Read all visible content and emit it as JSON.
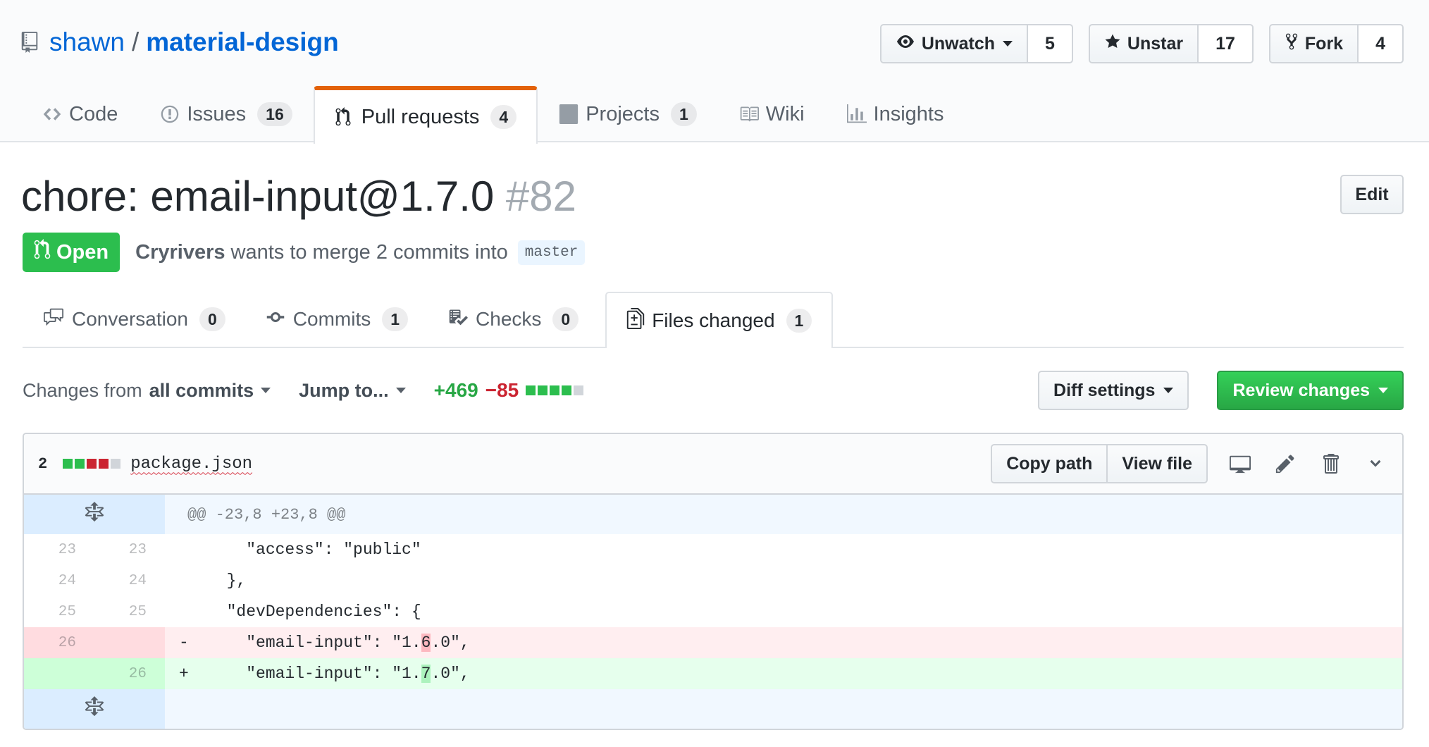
{
  "repo": {
    "owner": "shawn",
    "separator": "/",
    "name": "material-design"
  },
  "actions": {
    "watch": {
      "label": "Unwatch",
      "count": "5"
    },
    "star": {
      "label": "Unstar",
      "count": "17"
    },
    "fork": {
      "label": "Fork",
      "count": "4"
    }
  },
  "reponav": [
    {
      "label": "Code",
      "icon": "code-icon",
      "count": ""
    },
    {
      "label": "Issues",
      "icon": "issue-icon",
      "count": "16"
    },
    {
      "label": "Pull requests",
      "icon": "pull-request-icon",
      "count": "4",
      "selected": true
    },
    {
      "label": "Projects",
      "icon": "project-icon",
      "count": "1"
    },
    {
      "label": "Wiki",
      "icon": "book-icon",
      "count": ""
    },
    {
      "label": "Insights",
      "icon": "graph-icon",
      "count": ""
    }
  ],
  "pr": {
    "title": "chore: email-input@1.7.0",
    "number": "#82",
    "edit_label": "Edit",
    "state": "Open",
    "author": "Cryrivers",
    "merge_text": "wants to merge 2 commits into",
    "base_branch": "master"
  },
  "tabs": [
    {
      "label": "Conversation",
      "icon": "comment-discussion-icon",
      "count": "0"
    },
    {
      "label": "Commits",
      "icon": "git-commit-icon",
      "count": "1"
    },
    {
      "label": "Checks",
      "icon": "checklist-icon",
      "count": "0"
    },
    {
      "label": "Files changed",
      "icon": "diff-icon",
      "count": "1",
      "selected": true
    }
  ],
  "toolbar": {
    "changes_prefix": "Changes from",
    "changes_value": "all commits",
    "jump_label": "Jump to...",
    "additions": "+469",
    "deletions": "−85",
    "diff_settings": "Diff settings",
    "review_changes": "Review changes"
  },
  "file": {
    "change_count": "2",
    "name": "package.json",
    "copy_path": "Copy path",
    "view_file": "View file",
    "hunk_header": "@@ -23,8 +23,8 @@",
    "lines": [
      {
        "type": "context",
        "old": "23",
        "new": "23",
        "marker": "",
        "code": "    \"access\": \"public\""
      },
      {
        "type": "context",
        "old": "24",
        "new": "24",
        "marker": "",
        "code": "  },"
      },
      {
        "type": "context",
        "old": "25",
        "new": "25",
        "marker": "",
        "code": "  \"devDependencies\": {"
      },
      {
        "type": "del",
        "old": "26",
        "new": "",
        "marker": "-",
        "code_before": "    \"email-input\": \"1.",
        "code_changed": "6",
        "code_after": ".0\","
      },
      {
        "type": "add",
        "old": "",
        "new": "26",
        "marker": "+",
        "code_before": "    \"email-input\": \"1.",
        "code_changed": "7",
        "code_after": ".0\","
      }
    ]
  },
  "colors": {
    "link": "#0366d6",
    "selected_tab_accent": "#e36209",
    "open_state": "#2cbe4e",
    "addition": "#28a745",
    "deletion": "#cb2431"
  }
}
